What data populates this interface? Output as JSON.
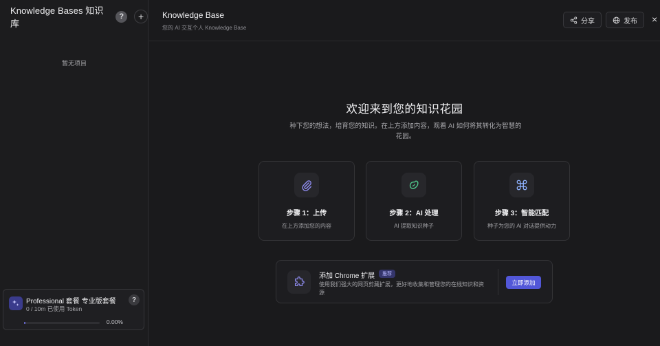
{
  "sidebar": {
    "title": "Knowledge Bases 知识库",
    "help_glyph": "?",
    "add_glyph": "+",
    "empty_text": "暂无项目",
    "plan": {
      "name": "Professional 套餐  专业版套餐",
      "usage": "0 / 10m 已使用 Token",
      "help_glyph": "?",
      "progress_fraction": 0.0,
      "percent_text": "0.00%"
    }
  },
  "topbar": {
    "title": "Knowledge Base",
    "subtitle": "您的 AI 交互个人 Knowledge Base",
    "share_label": "分享",
    "publish_label": "发布",
    "close_glyph": "×"
  },
  "welcome": {
    "title": "欢迎来到您的知识花园",
    "description": "种下您的想法，培育您的知识。在上方添加内容，观看 AI 如何将其转化为智慧的花园。"
  },
  "steps": [
    {
      "title": "步骤 1：上传",
      "description": "在上方添加您的内容",
      "icon": "paperclip-icon"
    },
    {
      "title": "步骤 2：AI 处理",
      "description": "AI 提取知识种子",
      "icon": "seed-icon"
    },
    {
      "title": "步骤 3：智能匹配",
      "description": "种子为您的 AI 对话提供动力",
      "icon": "command-icon"
    }
  ],
  "extension": {
    "title": "添加 Chrome 扩展",
    "badge": "推荐",
    "description": "使用我们强大的网页剪藏扩展，更好地收集和管理您的在线知识和资源",
    "button_label": "立即添加",
    "icon": "puzzle-icon"
  },
  "colors": {
    "accent": "#5257d8",
    "icon_purple": "#8f8cf0",
    "icon_green": "#4fc48a",
    "icon_blue": "#8fb2ff"
  }
}
